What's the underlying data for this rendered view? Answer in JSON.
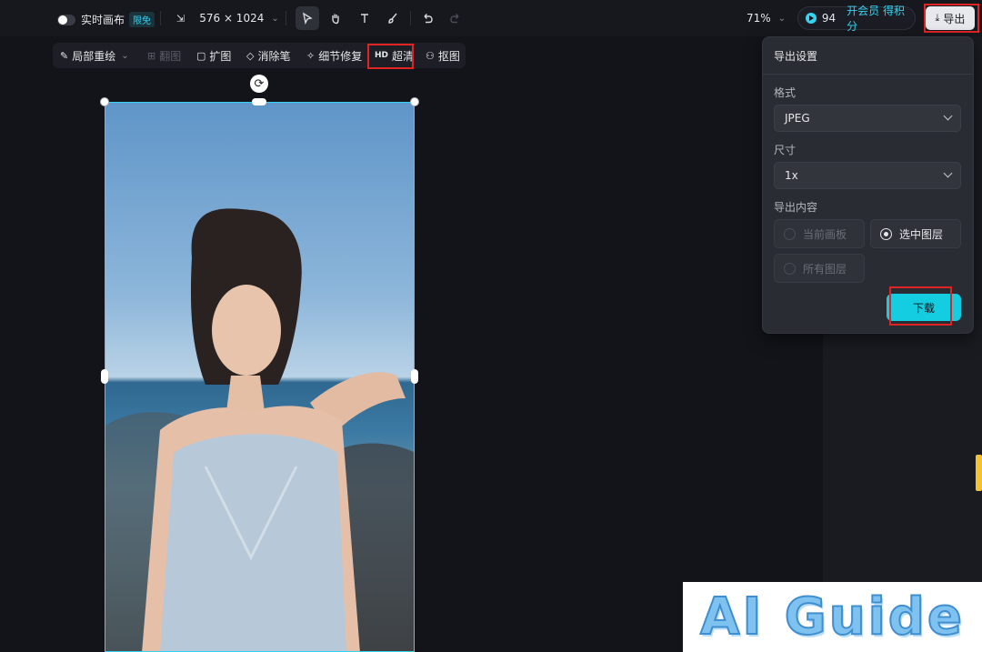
{
  "topbar": {
    "realtime_canvas_label": "实时画布",
    "limited_badge": "限免",
    "canvas_size": "576 × 1024",
    "zoom": "71%",
    "points": "94",
    "member_label": "开会员 得积分",
    "export_label": "导出"
  },
  "subtoolbar": {
    "items": [
      {
        "label": "局部重绘",
        "icon": "brush-icon"
      },
      {
        "label": "翻图",
        "icon": "flip-icon"
      },
      {
        "label": "扩图",
        "icon": "expand-icon"
      },
      {
        "label": "消除笔",
        "icon": "eraser-icon"
      },
      {
        "label": "细节修复",
        "icon": "repair-icon"
      },
      {
        "label": "超清",
        "icon": "hd-icon",
        "prefix": "HD"
      },
      {
        "label": "抠图",
        "icon": "cutout-icon"
      }
    ]
  },
  "export_panel": {
    "title": "导出设置",
    "format_label": "格式",
    "format_value": "JPEG",
    "size_label": "尺寸",
    "size_value": "1x",
    "content_label": "导出内容",
    "options": [
      {
        "label": "当前画板",
        "selected": false
      },
      {
        "label": "选中图层",
        "selected": true
      },
      {
        "label": "所有图层",
        "selected": false
      }
    ],
    "download_label": "下载"
  },
  "watermark": {
    "text": "AI Guide"
  },
  "colors": {
    "accent": "#14cde0",
    "highlight_box": "#e02424",
    "background": "#13141a"
  }
}
